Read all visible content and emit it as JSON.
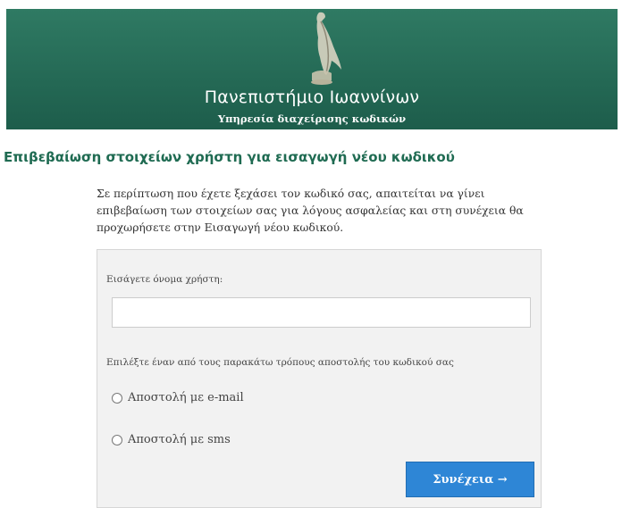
{
  "header": {
    "university_name": "Πανεπιστήμιο Ιωαννίνων",
    "service_name": "Υπηρεσία διαχείρισης κωδικών",
    "logo_icon": "eagle-statue-icon",
    "background_color": "#276b57"
  },
  "main": {
    "heading": "Επιβεβαίωση στοιχείων χρήστη για εισαγωγή νέου κωδικού",
    "intro_text": "Σε περίπτωση που έχετε ξεχάσει τον κωδικό σας, απαιτείται να γίνει επιβεβαίωση των στοιχείων σας για λόγους ασφαλείας και στη συνέχεια θα προχωρήσετε στην Εισαγωγή νέου κωδικού."
  },
  "form": {
    "username_label": "Εισάγετε όνομα χρήστη:",
    "username_value": "",
    "username_placeholder": "",
    "method_label": "Επιλέξτε έναν από τους παρακάτω τρόπους αποστολής του κωδικού σας",
    "options": [
      {
        "label": "Αποστολή με e-mail",
        "selected": false
      },
      {
        "label": "Αποστολή με sms",
        "selected": false
      }
    ],
    "continue_label": "Συνέχεια →",
    "button_color": "#2e86d6"
  }
}
